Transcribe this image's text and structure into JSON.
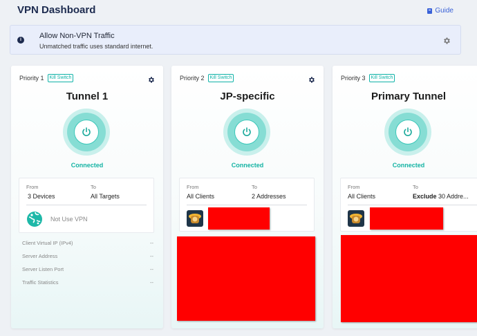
{
  "header": {
    "title": "VPN Dashboard",
    "guide_label": "Guide"
  },
  "banner": {
    "title": "Allow Non-VPN Traffic",
    "subtitle": "Unmatched traffic uses standard internet."
  },
  "cards": [
    {
      "priority": "Priority 1",
      "badge": "Kill Switch",
      "name": "Tunnel 1",
      "status": "Connected",
      "from_label": "From",
      "from_value": "3 Devices",
      "to_label": "To",
      "to_value": "All Targets",
      "vpn_note": "Not Use VPN",
      "stats": [
        {
          "label": "Client Virtual IP (IPv4)",
          "value": "--"
        },
        {
          "label": "Server Address",
          "value": "--"
        },
        {
          "label": "Server Listen Port",
          "value": "--"
        },
        {
          "label": "Traffic Statistics",
          "value": "--"
        }
      ]
    },
    {
      "priority": "Priority 2",
      "badge": "Kill Switch",
      "name": "JP-specific",
      "status": "Connected",
      "from_label": "From",
      "from_value": "All Clients",
      "to_label": "To",
      "to_value": "2 Addresses"
    },
    {
      "priority": "Priority 3",
      "badge": "Kill Switch",
      "name": "Primary Tunnel",
      "status": "Connected",
      "from_label": "From",
      "from_value": "All Clients",
      "to_label": "To",
      "to_value_bold": "Exclude",
      "to_value": "30 Addre..."
    }
  ],
  "colors": {
    "accent": "#14b3a3",
    "link": "#3a62d8",
    "redaction": "#ff0000"
  },
  "icons": [
    "book-icon",
    "info-icon",
    "gear-icon",
    "power-icon",
    "globe-icon",
    "avatar-icon"
  ]
}
